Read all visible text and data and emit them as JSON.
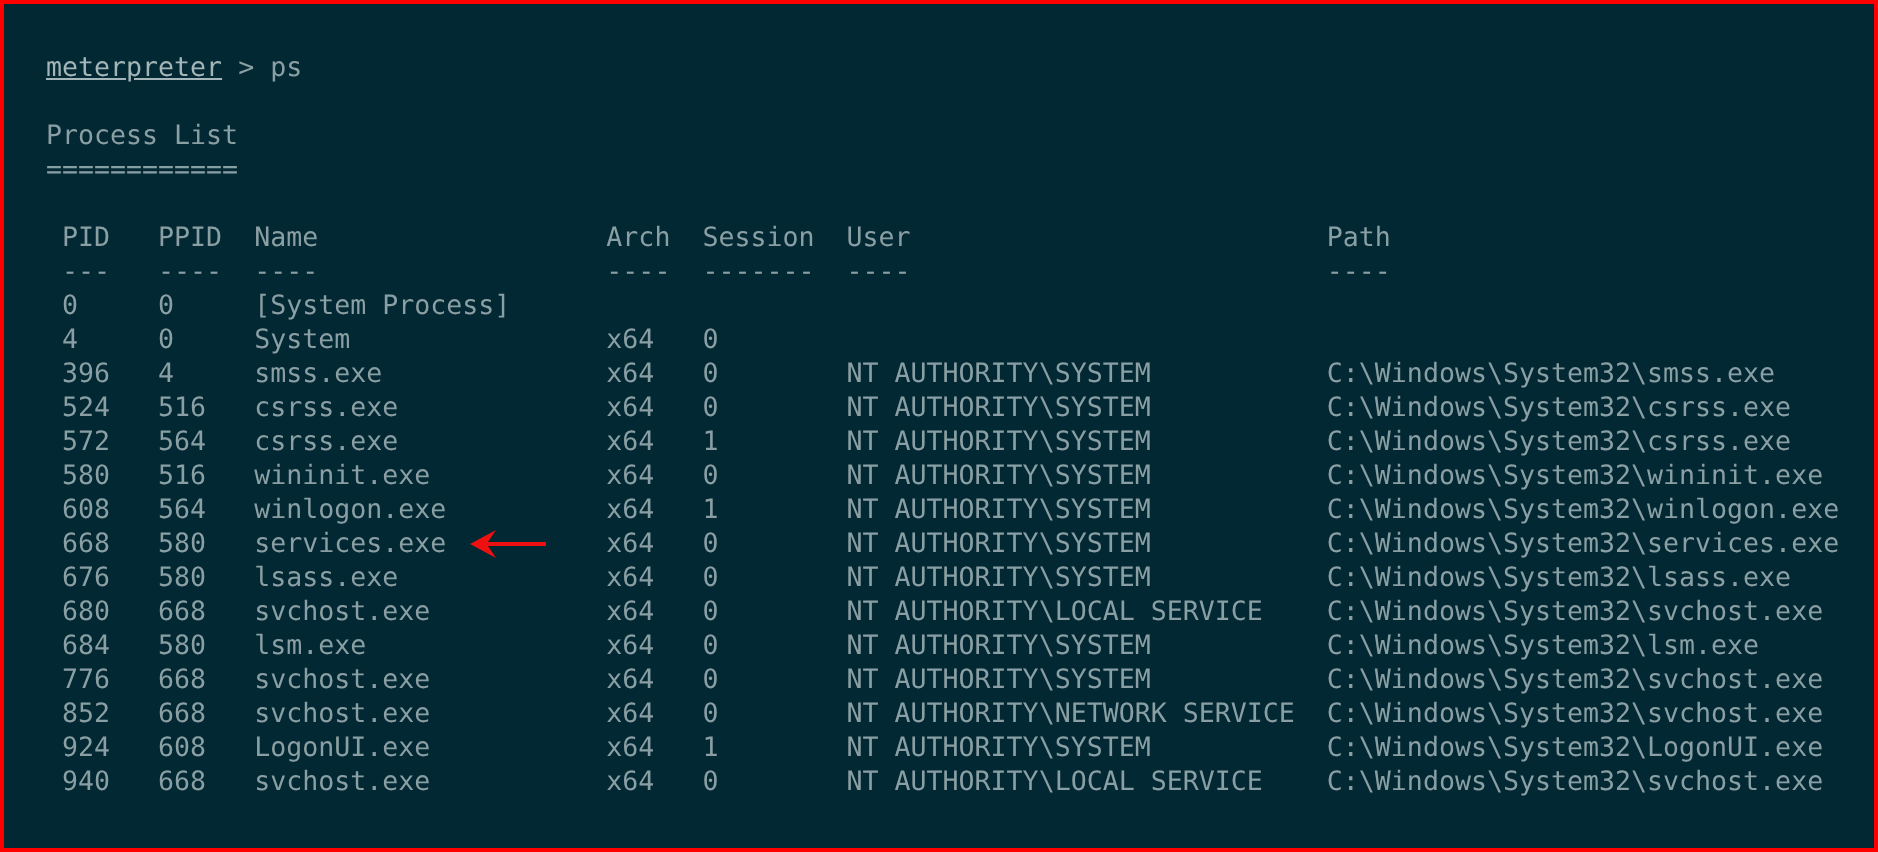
{
  "prompt": {
    "name": "meterpreter",
    "separator": ">",
    "command": "ps"
  },
  "title": "Process List",
  "title_rule": "============",
  "table": {
    "columns": [
      {
        "label": "PID",
        "rule": "---"
      },
      {
        "label": "PPID",
        "rule": "----"
      },
      {
        "label": "Name",
        "rule": "----"
      },
      {
        "label": "Arch",
        "rule": "----"
      },
      {
        "label": "Session",
        "rule": "-------"
      },
      {
        "label": "User",
        "rule": "----"
      },
      {
        "label": "Path",
        "rule": "----"
      }
    ],
    "rows": [
      {
        "cells": [
          "0",
          "0",
          "[System Process]",
          "",
          "",
          "",
          ""
        ],
        "marked": false
      },
      {
        "cells": [
          "4",
          "0",
          "System",
          "x64",
          "0",
          "",
          ""
        ],
        "marked": false
      },
      {
        "cells": [
          "396",
          "4",
          "smss.exe",
          "x64",
          "0",
          "NT AUTHORITY\\SYSTEM",
          "C:\\Windows\\System32\\smss.exe"
        ],
        "marked": false
      },
      {
        "cells": [
          "524",
          "516",
          "csrss.exe",
          "x64",
          "0",
          "NT AUTHORITY\\SYSTEM",
          "C:\\Windows\\System32\\csrss.exe"
        ],
        "marked": false
      },
      {
        "cells": [
          "572",
          "564",
          "csrss.exe",
          "x64",
          "1",
          "NT AUTHORITY\\SYSTEM",
          "C:\\Windows\\System32\\csrss.exe"
        ],
        "marked": false
      },
      {
        "cells": [
          "580",
          "516",
          "wininit.exe",
          "x64",
          "0",
          "NT AUTHORITY\\SYSTEM",
          "C:\\Windows\\System32\\wininit.exe"
        ],
        "marked": false
      },
      {
        "cells": [
          "608",
          "564",
          "winlogon.exe",
          "x64",
          "1",
          "NT AUTHORITY\\SYSTEM",
          "C:\\Windows\\System32\\winlogon.exe"
        ],
        "marked": false
      },
      {
        "cells": [
          "668",
          "580",
          "services.exe",
          "x64",
          "0",
          "NT AUTHORITY\\SYSTEM",
          "C:\\Windows\\System32\\services.exe"
        ],
        "marked": true
      },
      {
        "cells": [
          "676",
          "580",
          "lsass.exe",
          "x64",
          "0",
          "NT AUTHORITY\\SYSTEM",
          "C:\\Windows\\System32\\lsass.exe"
        ],
        "marked": false
      },
      {
        "cells": [
          "680",
          "668",
          "svchost.exe",
          "x64",
          "0",
          "NT AUTHORITY\\LOCAL SERVICE",
          "C:\\Windows\\System32\\svchost.exe"
        ],
        "marked": false
      },
      {
        "cells": [
          "684",
          "580",
          "lsm.exe",
          "x64",
          "0",
          "NT AUTHORITY\\SYSTEM",
          "C:\\Windows\\System32\\lsm.exe"
        ],
        "marked": false
      },
      {
        "cells": [
          "776",
          "668",
          "svchost.exe",
          "x64",
          "0",
          "NT AUTHORITY\\SYSTEM",
          "C:\\Windows\\System32\\svchost.exe"
        ],
        "marked": false
      },
      {
        "cells": [
          "852",
          "668",
          "svchost.exe",
          "x64",
          "0",
          "NT AUTHORITY\\NETWORK SERVICE",
          "C:\\Windows\\System32\\svchost.exe"
        ],
        "marked": false
      },
      {
        "cells": [
          "924",
          "608",
          "LogonUI.exe",
          "x64",
          "1",
          "NT AUTHORITY\\SYSTEM",
          "C:\\Windows\\System32\\LogonUI.exe"
        ],
        "marked": false
      },
      {
        "cells": [
          "940",
          "668",
          "svchost.exe",
          "x64",
          "0",
          "NT AUTHORITY\\LOCAL SERVICE",
          "C:\\Windows\\System32\\svchost.exe"
        ],
        "marked": false
      }
    ]
  }
}
